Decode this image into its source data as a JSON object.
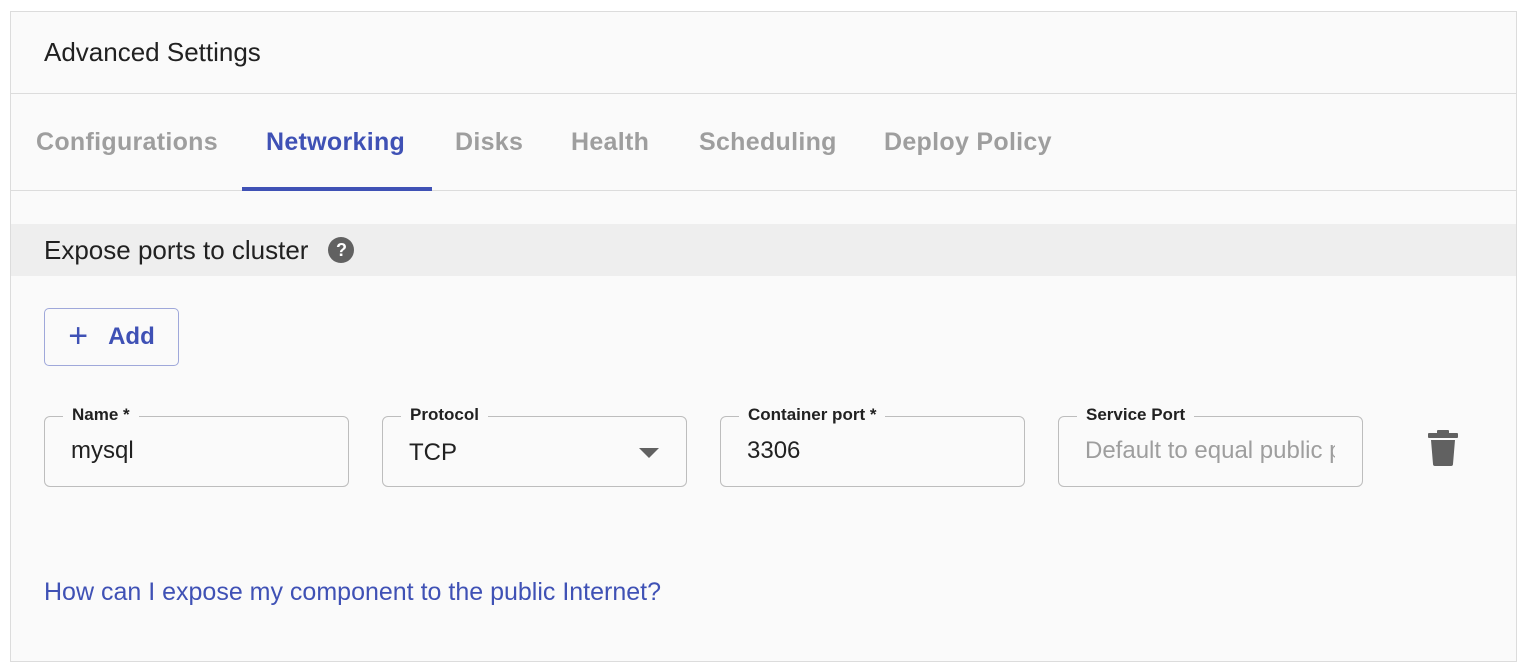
{
  "header": {
    "title": "Advanced Settings"
  },
  "tabs": [
    {
      "label": "Configurations",
      "active": false
    },
    {
      "label": "Networking",
      "active": true
    },
    {
      "label": "Disks",
      "active": false
    },
    {
      "label": "Health",
      "active": false
    },
    {
      "label": "Scheduling",
      "active": false
    },
    {
      "label": "Deploy Policy",
      "active": false
    }
  ],
  "section": {
    "title": "Expose ports to cluster",
    "help_glyph": "?"
  },
  "add_button": {
    "icon": "+",
    "label": "Add"
  },
  "port_row": {
    "name": {
      "label": "Name *",
      "value": "mysql"
    },
    "protocol": {
      "label": "Protocol",
      "value": "TCP"
    },
    "container_port": {
      "label": "Container port *",
      "value": "3306"
    },
    "service_port": {
      "label": "Service Port",
      "value": "",
      "placeholder": "Default to equal public port"
    }
  },
  "footer": {
    "link": "How can I expose my component to the public Internet?"
  },
  "colors": {
    "accent": "#3f51b5",
    "muted_tab": "#9e9e9e",
    "section_bar": "#eeeeee",
    "icon_gray": "#616161"
  }
}
